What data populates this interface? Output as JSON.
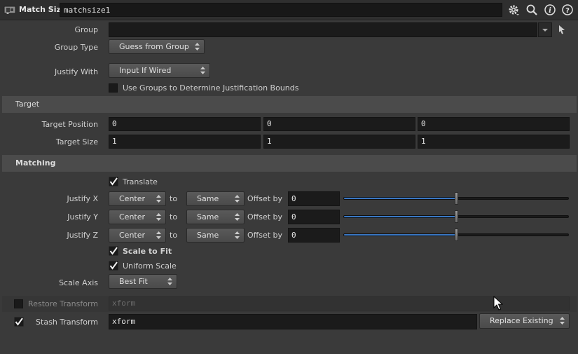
{
  "header": {
    "node_type": "Match Size",
    "node_name": "matchsize1",
    "icons": [
      "node-type-icon",
      "gear-icon",
      "search-icon",
      "info-icon",
      "help-icon"
    ]
  },
  "group": {
    "label": "Group",
    "value": "",
    "group_type_label": "Group Type",
    "group_type_value": "Guess from Group"
  },
  "justify_with": {
    "label": "Justify With",
    "value": "Input If Wired"
  },
  "use_groups": {
    "label": "Use Groups to Determine Justification Bounds",
    "checked": false
  },
  "target": {
    "section_title": "Target",
    "position_label": "Target Position",
    "position": [
      "0",
      "0",
      "0"
    ],
    "size_label": "Target Size",
    "size": [
      "1",
      "1",
      "1"
    ]
  },
  "matching": {
    "section_title": "Matching",
    "translate_label": "Translate",
    "translate_checked": true,
    "rows": [
      {
        "label": "Justify X",
        "justify": "Center",
        "to_label": "to",
        "to": "Same",
        "offset_label": "Offset by",
        "offset": "0",
        "slider_fraction": 0.5
      },
      {
        "label": "Justify Y",
        "justify": "Center",
        "to_label": "to",
        "to": "Same",
        "offset_label": "Offset by",
        "offset": "0",
        "slider_fraction": 0.5
      },
      {
        "label": "Justify Z",
        "justify": "Center",
        "to_label": "to",
        "to": "Same",
        "offset_label": "Offset by",
        "offset": "0",
        "slider_fraction": 0.5
      }
    ],
    "scale_to_fit_label": "Scale to Fit",
    "scale_to_fit_checked": true,
    "uniform_scale_label": "Uniform Scale",
    "uniform_scale_checked": true,
    "scale_axis_label": "Scale Axis",
    "scale_axis_value": "Best Fit"
  },
  "restore": {
    "label": "Restore Transform",
    "checked": false,
    "value": "xform"
  },
  "stash": {
    "label": "Stash Transform",
    "checked": true,
    "value": "xform",
    "mode": "Replace Existing"
  },
  "colors": {
    "background": "#3a3a3a",
    "field": "#1b1b1b",
    "section": "#4b4b4b",
    "slider_fill": "#3a78c4"
  }
}
